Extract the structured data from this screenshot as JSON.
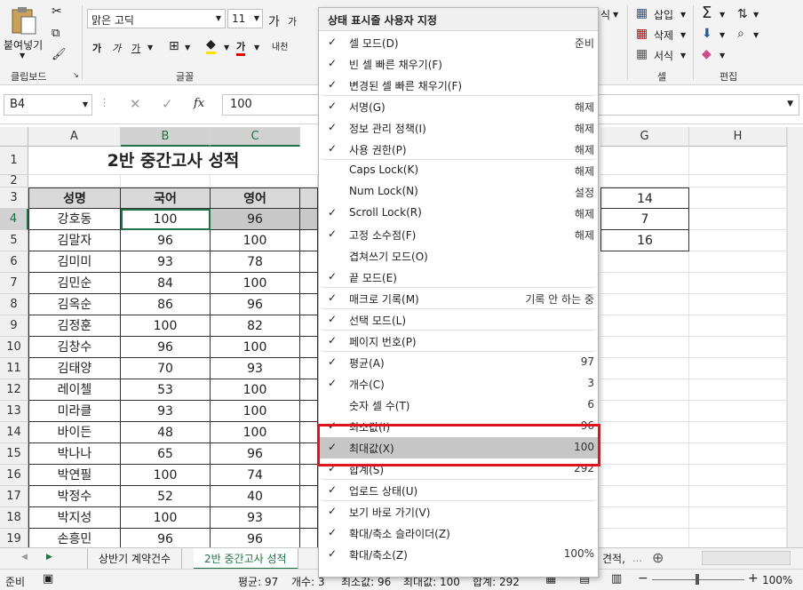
{
  "ribbon": {
    "paste_label": "붙여넣기",
    "font_name": "맑은 고딕",
    "font_size": "11",
    "bold_label": "가",
    "italic_label": "가",
    "underline_label": "가",
    "font_color_label": "가",
    "phonetic_label": "내천",
    "grow_font_label": "가",
    "shrink_font_label": "가",
    "style_cut_label": "식",
    "insert_label": "삽입",
    "delete_label": "삭제",
    "format_label": "서식",
    "groups": {
      "clipboard": "클립보드",
      "font": "글꼴",
      "cells": "셀",
      "editing": "편집"
    }
  },
  "formula_bar": {
    "name_box": "B4",
    "fx": "fx",
    "value": "100"
  },
  "columns": [
    "A",
    "B",
    "C",
    "G",
    "H"
  ],
  "rows": [
    "1",
    "2",
    "3",
    "4",
    "5",
    "6",
    "7",
    "8",
    "9",
    "10",
    "11",
    "12",
    "13",
    "14",
    "15",
    "16",
    "17",
    "18",
    "19"
  ],
  "sheet": {
    "title": "2반 중간고사 성적",
    "headers": [
      "성명",
      "국어",
      "영어"
    ],
    "data": [
      [
        "강호동",
        "100",
        "96"
      ],
      [
        "김말자",
        "96",
        "100"
      ],
      [
        "김미미",
        "93",
        "78"
      ],
      [
        "김민순",
        "84",
        "100"
      ],
      [
        "김옥순",
        "86",
        "96"
      ],
      [
        "김정훈",
        "100",
        "82"
      ],
      [
        "김창수",
        "96",
        "100"
      ],
      [
        "김태양",
        "70",
        "93"
      ],
      [
        "레이첼",
        "53",
        "100"
      ],
      [
        "미라클",
        "93",
        "100"
      ],
      [
        "바이든",
        "48",
        "100"
      ],
      [
        "박나나",
        "65",
        "96"
      ],
      [
        "박연필",
        "100",
        "74"
      ],
      [
        "박정수",
        "52",
        "40"
      ],
      [
        "박지성",
        "100",
        "93"
      ],
      [
        "손흥민",
        "96",
        "96"
      ]
    ],
    "g_values": [
      "14",
      "7",
      "16"
    ]
  },
  "tabs": {
    "first": "상반기 계약건수",
    "active": "2반 중간고사 성적",
    "partial": "견적,"
  },
  "status": {
    "ready": "준비",
    "avg": "평균: 97",
    "count": "개수: 3",
    "min": "최소값: 96",
    "max": "최대값: 100",
    "sum": "합계: 292",
    "zoom": "100%"
  },
  "menu": {
    "title": "상태 표시줄 사용자 지정",
    "items": [
      {
        "checked": true,
        "label": "셀 모드(D)",
        "value": "준비"
      },
      {
        "checked": true,
        "label": "빈 셀 빠른 채우기(F)",
        "value": ""
      },
      {
        "checked": true,
        "label": "변경된 셀 빠른 채우기(F)",
        "value": ""
      },
      {
        "checked": true,
        "label": "서명(G)",
        "value": "해제"
      },
      {
        "checked": true,
        "label": "정보 관리 정책(I)",
        "value": "해제"
      },
      {
        "checked": true,
        "label": "사용 권한(P)",
        "value": "해제"
      },
      {
        "checked": false,
        "label": "Caps Lock(K)",
        "value": "해제"
      },
      {
        "checked": false,
        "label": "Num Lock(N)",
        "value": "설정"
      },
      {
        "checked": true,
        "label": "Scroll Lock(R)",
        "value": "해제"
      },
      {
        "checked": true,
        "label": "고정 소수점(F)",
        "value": "해제"
      },
      {
        "checked": false,
        "label": "겹쳐쓰기 모드(O)",
        "value": ""
      },
      {
        "checked": true,
        "label": "끝 모드(E)",
        "value": ""
      },
      {
        "checked": true,
        "label": "매크로 기록(M)",
        "value": "기록 안 하는 중"
      },
      {
        "checked": true,
        "label": "선택 모드(L)",
        "value": ""
      },
      {
        "checked": true,
        "label": "페이지 번호(P)",
        "value": ""
      },
      {
        "checked": true,
        "label": "평균(A)",
        "value": "97"
      },
      {
        "checked": true,
        "label": "개수(C)",
        "value": "3"
      },
      {
        "checked": false,
        "label": "숫자 셀 수(T)",
        "value": "6"
      },
      {
        "checked": true,
        "label": "최소값(I)",
        "value": "96"
      },
      {
        "checked": true,
        "label": "최대값(X)",
        "value": "100"
      },
      {
        "checked": true,
        "label": "합계(S)",
        "value": "292"
      },
      {
        "checked": true,
        "label": "업로드 상태(U)",
        "value": ""
      },
      {
        "checked": true,
        "label": "보기 바로 가기(V)",
        "value": ""
      },
      {
        "checked": true,
        "label": "확대/축소 슬라이더(Z)",
        "value": ""
      },
      {
        "checked": true,
        "label": "확대/축소(Z)",
        "value": "100%"
      }
    ]
  },
  "colors": {
    "accent": "#217346",
    "highlight": "#e0141e"
  }
}
